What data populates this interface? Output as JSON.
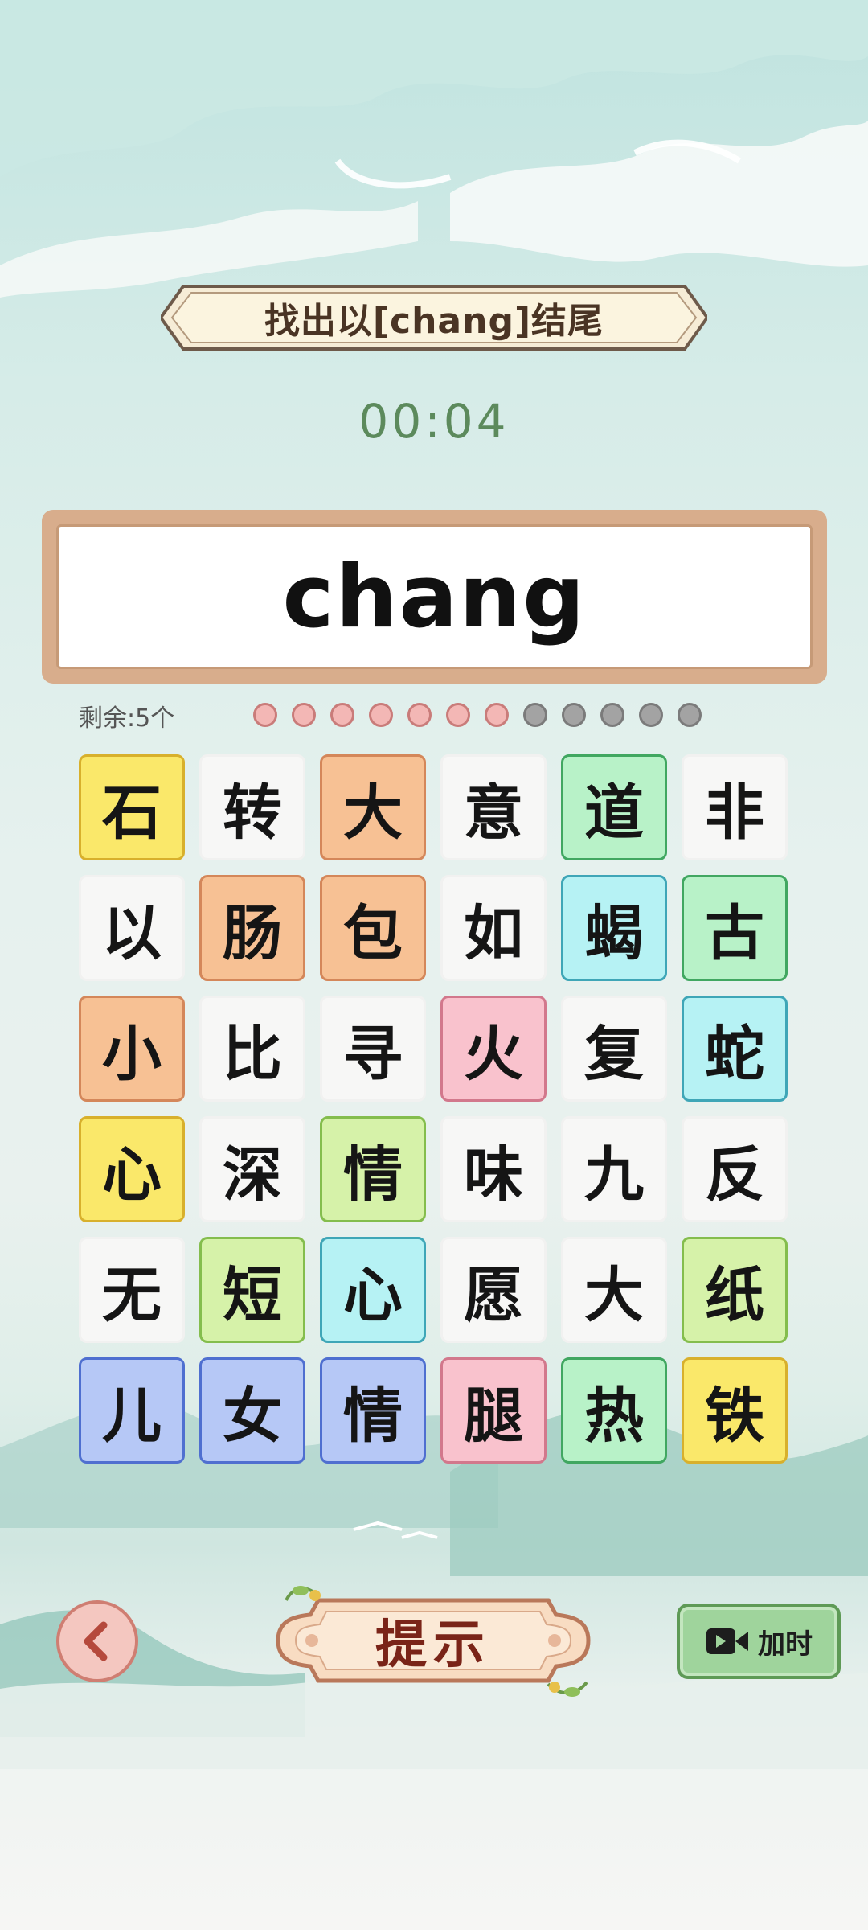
{
  "game": {
    "prompt": "找出以[chang]结尾",
    "timer": "00:04",
    "target_word": "chang",
    "remaining_label": "剩余:5个",
    "progress": {
      "filled": 7,
      "total": 12
    }
  },
  "grid": [
    [
      {
        "char": "石",
        "color": "yellow"
      },
      {
        "char": "转",
        "color": "white"
      },
      {
        "char": "大",
        "color": "orange"
      },
      {
        "char": "意",
        "color": "white"
      },
      {
        "char": "道",
        "color": "green"
      },
      {
        "char": "非",
        "color": "white"
      }
    ],
    [
      {
        "char": "以",
        "color": "white"
      },
      {
        "char": "肠",
        "color": "orange"
      },
      {
        "char": "包",
        "color": "orange"
      },
      {
        "char": "如",
        "color": "white"
      },
      {
        "char": "蝎",
        "color": "cyan"
      },
      {
        "char": "古",
        "color": "green"
      }
    ],
    [
      {
        "char": "小",
        "color": "orange"
      },
      {
        "char": "比",
        "color": "white"
      },
      {
        "char": "寻",
        "color": "white"
      },
      {
        "char": "火",
        "color": "pink"
      },
      {
        "char": "复",
        "color": "white"
      },
      {
        "char": "蛇",
        "color": "cyan"
      }
    ],
    [
      {
        "char": "心",
        "color": "yellow"
      },
      {
        "char": "深",
        "color": "white"
      },
      {
        "char": "情",
        "color": "lime"
      },
      {
        "char": "味",
        "color": "white"
      },
      {
        "char": "九",
        "color": "white"
      },
      {
        "char": "反",
        "color": "white"
      }
    ],
    [
      {
        "char": "无",
        "color": "white"
      },
      {
        "char": "短",
        "color": "lime"
      },
      {
        "char": "心",
        "color": "cyan"
      },
      {
        "char": "愿",
        "color": "white"
      },
      {
        "char": "大",
        "color": "white"
      },
      {
        "char": "纸",
        "color": "lime"
      }
    ],
    [
      {
        "char": "儿",
        "color": "blue"
      },
      {
        "char": "女",
        "color": "blue"
      },
      {
        "char": "情",
        "color": "blue"
      },
      {
        "char": "腿",
        "color": "pink"
      },
      {
        "char": "热",
        "color": "green"
      },
      {
        "char": "铁",
        "color": "yellow"
      }
    ]
  ],
  "controls": {
    "back_icon": "back-arrow-icon",
    "hint_label": "提示",
    "add_time_label": "加时",
    "add_time_icon": "video-camera-icon"
  },
  "colors": {
    "timer": "#5c8a5c",
    "dot_filled": "#f3b7b5",
    "dot_empty": "#a3a3a3"
  }
}
